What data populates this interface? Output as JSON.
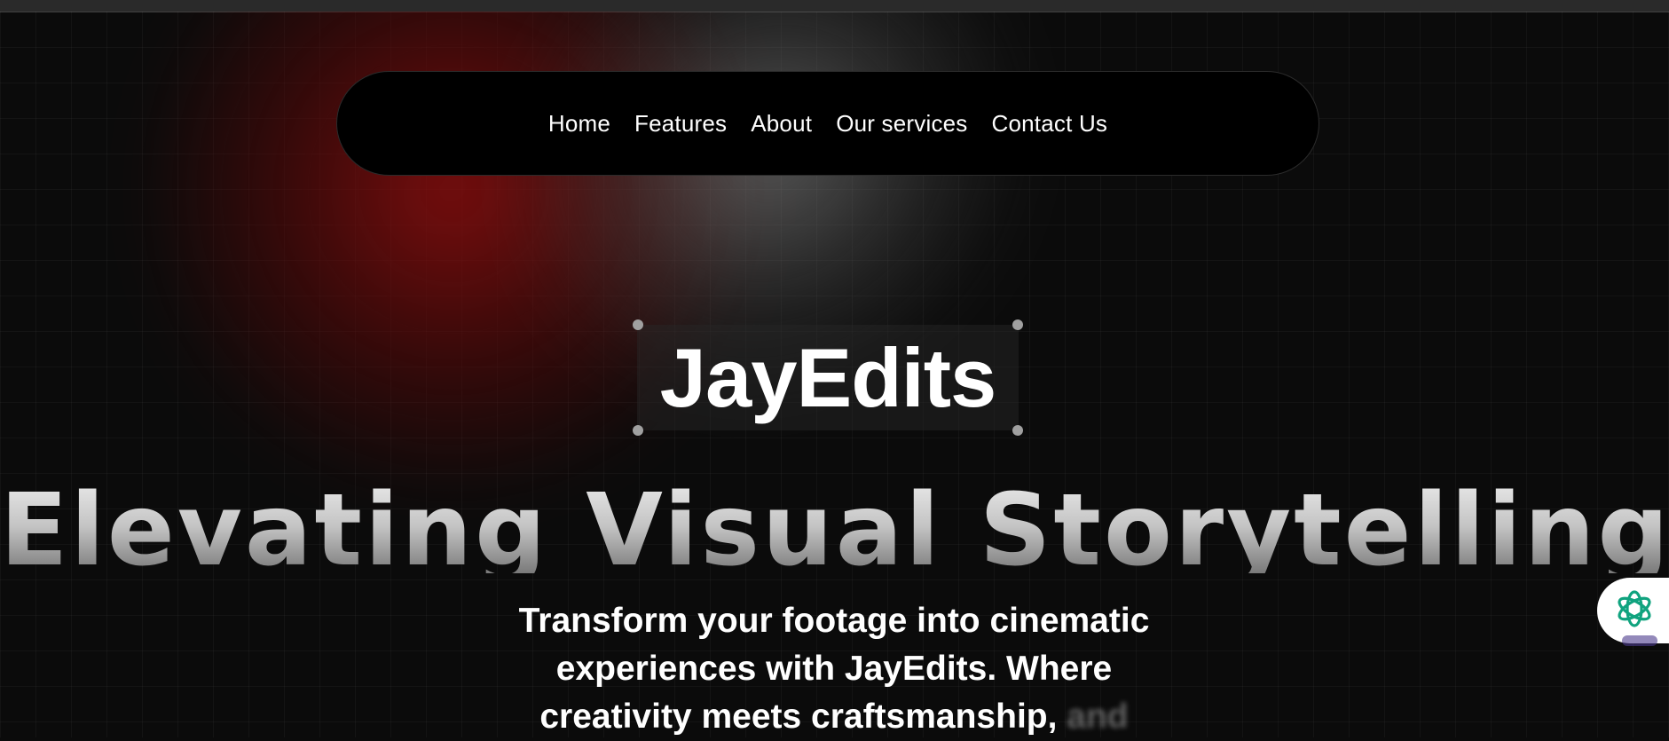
{
  "nav": {
    "items": [
      {
        "label": "Home"
      },
      {
        "label": "Features"
      },
      {
        "label": "About"
      },
      {
        "label": "Our services"
      },
      {
        "label": "Contact Us"
      }
    ]
  },
  "hero": {
    "brand": "JayEdits",
    "headline": "Elevating Visual Storytelling",
    "subtitle_lines": [
      "Transform your footage into cinematic",
      "experiences with JayEdits. Where",
      "creativity meets craftsmanship,"
    ],
    "subtitle_faded": "and"
  },
  "widget": {
    "icon": "openai-knot-icon"
  },
  "colors": {
    "background": "#0b0b0b",
    "nav_bg": "#000000",
    "glow_red": "#8c0e0e",
    "text": "#ffffff",
    "widget_icon": "#10a37f"
  }
}
